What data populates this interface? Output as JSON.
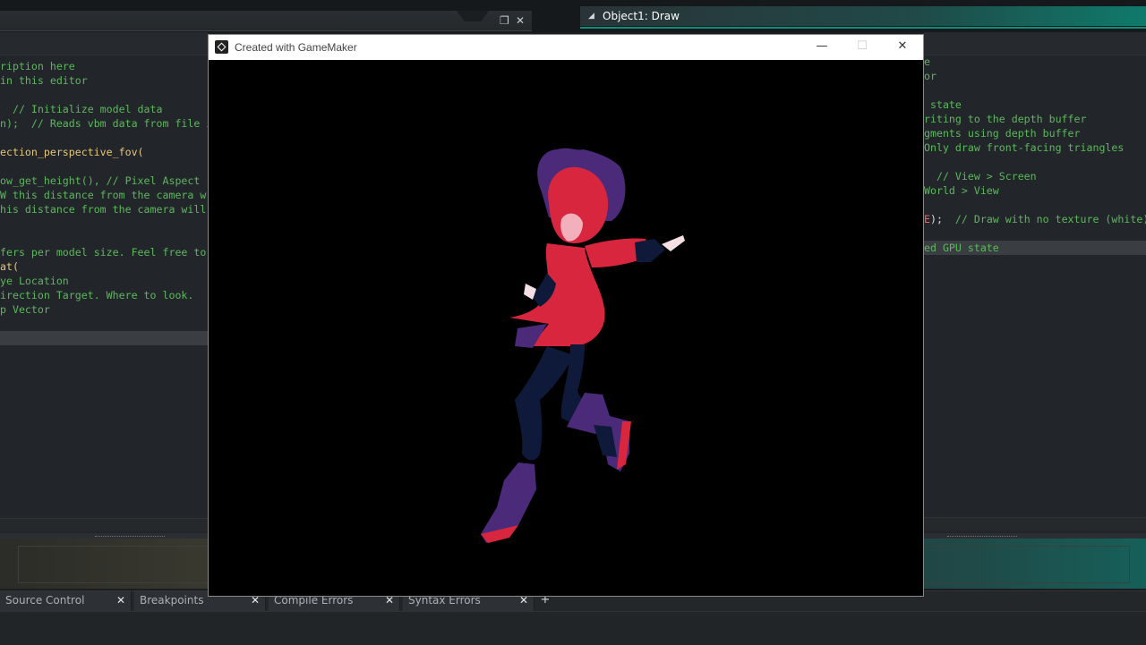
{
  "ide": {
    "right_tab_title": "Object1: Draw",
    "left_code_lines": [
      {
        "text": "ription here",
        "cls": ""
      },
      {
        "text": "in this editor",
        "cls": ""
      },
      {
        "text": "",
        "cls": ""
      },
      {
        "text": "  // Initialize model data",
        "cls": ""
      },
      {
        "text": "n);  // Reads vbm data from file i",
        "cls": ""
      },
      {
        "text": "",
        "cls": ""
      },
      {
        "text": "ection_perspective_fov(",
        "cls": "c-func"
      },
      {
        "text": "",
        "cls": ""
      },
      {
        "text": "ow_get_height(), // Pixel Aspect r",
        "cls": ""
      },
      {
        "text": "W this distance from the camera w",
        "cls": ""
      },
      {
        "text": "his distance from the camera will",
        "cls": ""
      },
      {
        "text": "",
        "cls": ""
      },
      {
        "text": "",
        "cls": ""
      },
      {
        "text": "fers per model size. Feel free to",
        "cls": ""
      },
      {
        "text": "at(",
        "cls": "c-func"
      },
      {
        "text": "ye Location",
        "cls": ""
      },
      {
        "text": "irection Target. Where to look.",
        "cls": ""
      },
      {
        "text": "p Vector",
        "cls": ""
      }
    ],
    "right_code_lines": [
      {
        "text": "e",
        "cls": ""
      },
      {
        "text": "or",
        "cls": ""
      },
      {
        "text": "",
        "cls": ""
      },
      {
        "text": " state",
        "cls": ""
      },
      {
        "text": "riting to the depth buffer",
        "cls": ""
      },
      {
        "text": "gments using depth buffer",
        "cls": ""
      },
      {
        "text": "Only draw front-facing triangles",
        "cls": ""
      },
      {
        "text": "",
        "cls": ""
      },
      {
        "text": "  // View > Screen",
        "cls": ""
      },
      {
        "text": "World > View",
        "cls": ""
      },
      {
        "text": "",
        "cls": ""
      },
      {
        "text": "E);  // Draw with no texture (white)",
        "cls": "mixed"
      },
      {
        "text": "",
        "cls": ""
      },
      {
        "text": "ed GPU state",
        "cls": ""
      }
    ],
    "bottom_tabs": [
      {
        "label": "Source Control",
        "close": "✕"
      },
      {
        "label": "Breakpoints",
        "close": "✕"
      },
      {
        "label": "Compile Errors",
        "close": "✕"
      },
      {
        "label": "Syntax Errors",
        "close": "✕"
      }
    ],
    "add_tab": "+"
  },
  "game_window": {
    "title": "Created with GameMaker",
    "minimize": "—",
    "maximize": "☐",
    "close": "✕"
  },
  "colors": {
    "code_comment": "#5cb85c",
    "code_function": "#e8c678",
    "character_red": "#d8263f",
    "character_purple": "#4b2a7a",
    "character_navy": "#0f1a3a"
  }
}
